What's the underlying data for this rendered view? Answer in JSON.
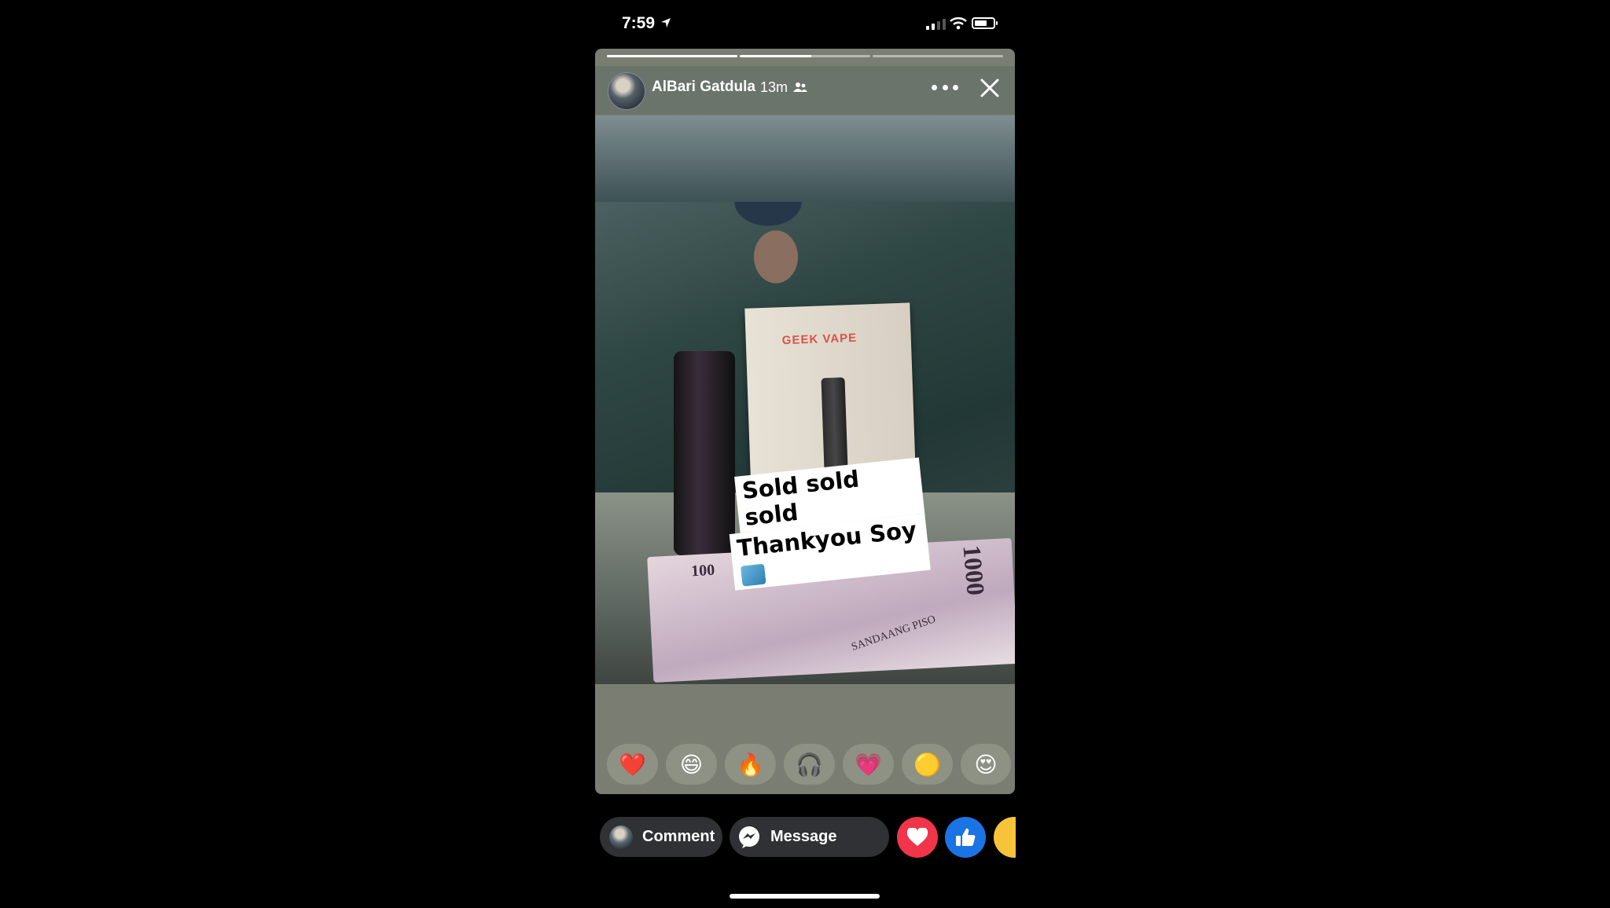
{
  "status_bar": {
    "time": "7:59",
    "signal_icon": "cellular-signal-icon",
    "wifi_icon": "wifi-icon",
    "battery_icon": "battery-icon"
  },
  "story": {
    "progress": [
      1.0,
      0.55,
      0.0
    ],
    "author": "AlBari Gatdula",
    "time_ago": "13m",
    "audience_icon": "friends-icon",
    "caption_line1": "Sold sold sold",
    "caption_line2": "Thankyou Soy",
    "photo_text": {
      "brand": "GEEK VAPE",
      "note_100": "100",
      "note_1000": "1000",
      "note_piso": "SANDAANG PISO"
    },
    "reactions": [
      "❤️",
      "😄",
      "🔥",
      "🎧",
      "💗",
      "🟡",
      "😍"
    ]
  },
  "bottom_bar": {
    "comment_label": "Comment",
    "message_label": "Message",
    "quick_reactions": [
      "love",
      "like",
      "haha"
    ]
  },
  "colors": {
    "love": "#f0344a",
    "like": "#1b74e4",
    "haha": "#f7c33b"
  }
}
